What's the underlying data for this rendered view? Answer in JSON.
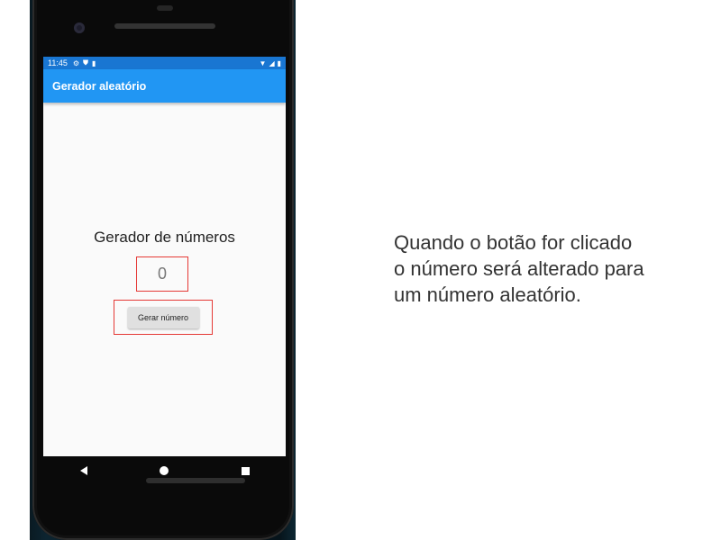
{
  "status_bar": {
    "time": "11:45",
    "left_icons": [
      "gear-icon",
      "shield-icon",
      "sd-card-icon"
    ],
    "right_icons": [
      "wifi-icon",
      "signal-icon",
      "battery-icon"
    ]
  },
  "app_bar": {
    "title": "Gerador aleatório",
    "color": "#2196f3",
    "status_color": "#1976d2"
  },
  "main": {
    "heading": "Gerador de números",
    "number_value": "0",
    "button_label": "Gerar número",
    "highlight_color": "#e53935"
  },
  "nav_bar": {
    "icons": [
      "back-icon",
      "home-icon",
      "recents-icon"
    ]
  },
  "caption": {
    "lines": [
      "Quando o botão for clicado",
      "o número será alterado para",
      "um número aleatório."
    ]
  }
}
